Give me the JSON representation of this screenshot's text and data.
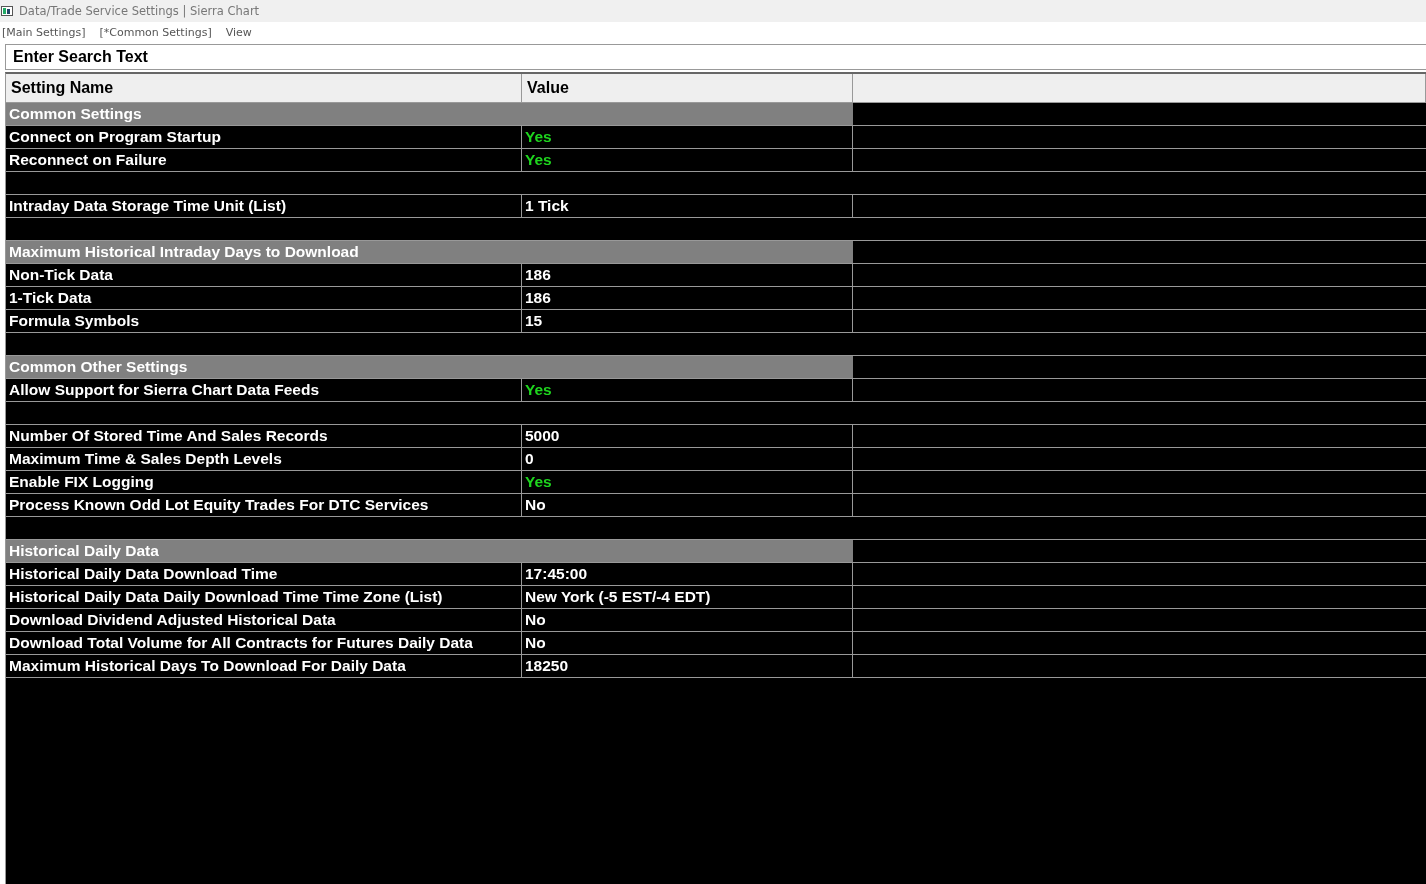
{
  "window": {
    "title": "Data/Trade Service Settings | Sierra Chart"
  },
  "menu": [
    "[Main Settings]",
    "[*Common Settings]",
    "View"
  ],
  "search": {
    "value": "Enter Search Text"
  },
  "table": {
    "columns": [
      "Setting Name",
      "Value"
    ],
    "rows": [
      {
        "kind": "group",
        "name": "Common Settings"
      },
      {
        "kind": "setting",
        "name": "Connect on Program Startup",
        "value": "Yes",
        "on": true
      },
      {
        "kind": "setting",
        "name": "Reconnect on Failure",
        "value": "Yes",
        "on": true
      },
      {
        "kind": "blank"
      },
      {
        "kind": "setting",
        "name": "Intraday Data Storage Time Unit (List)",
        "value": "1 Tick",
        "on": false
      },
      {
        "kind": "blank"
      },
      {
        "kind": "group",
        "name": "Maximum Historical Intraday Days to Download"
      },
      {
        "kind": "setting",
        "name": "Non-Tick Data",
        "value": "186",
        "on": false
      },
      {
        "kind": "setting",
        "name": "1-Tick Data",
        "value": "186",
        "on": false
      },
      {
        "kind": "setting",
        "name": "Formula Symbols",
        "value": "15",
        "on": false
      },
      {
        "kind": "blank"
      },
      {
        "kind": "group",
        "name": "Common Other Settings"
      },
      {
        "kind": "setting",
        "name": "Allow Support for Sierra Chart Data Feeds",
        "value": "Yes",
        "on": true
      },
      {
        "kind": "blank"
      },
      {
        "kind": "setting",
        "name": "Number Of Stored Time And Sales Records",
        "value": "5000",
        "on": false
      },
      {
        "kind": "setting",
        "name": "Maximum Time & Sales Depth Levels",
        "value": "0",
        "on": false
      },
      {
        "kind": "setting",
        "name": "Enable FIX Logging",
        "value": "Yes",
        "on": true
      },
      {
        "kind": "setting",
        "name": "Process Known Odd Lot Equity Trades For DTC Services",
        "value": "No",
        "on": false
      },
      {
        "kind": "blank"
      },
      {
        "kind": "group",
        "name": "Historical Daily Data"
      },
      {
        "kind": "setting",
        "name": "Historical Daily Data Download Time",
        "value": "17:45:00",
        "on": false
      },
      {
        "kind": "setting",
        "name": "Historical Daily Data Daily Download Time Time Zone (List)",
        "value": "New York (-5 EST/-4 EDT)",
        "on": false
      },
      {
        "kind": "setting",
        "name": "Download Dividend Adjusted Historical Data",
        "value": "No",
        "on": false
      },
      {
        "kind": "setting",
        "name": "Download Total Volume for All Contracts for Futures Daily Data",
        "value": "No",
        "on": false
      },
      {
        "kind": "setting",
        "name": "Maximum Historical Days To Download For Daily Data",
        "value": "18250",
        "on": false
      }
    ]
  }
}
